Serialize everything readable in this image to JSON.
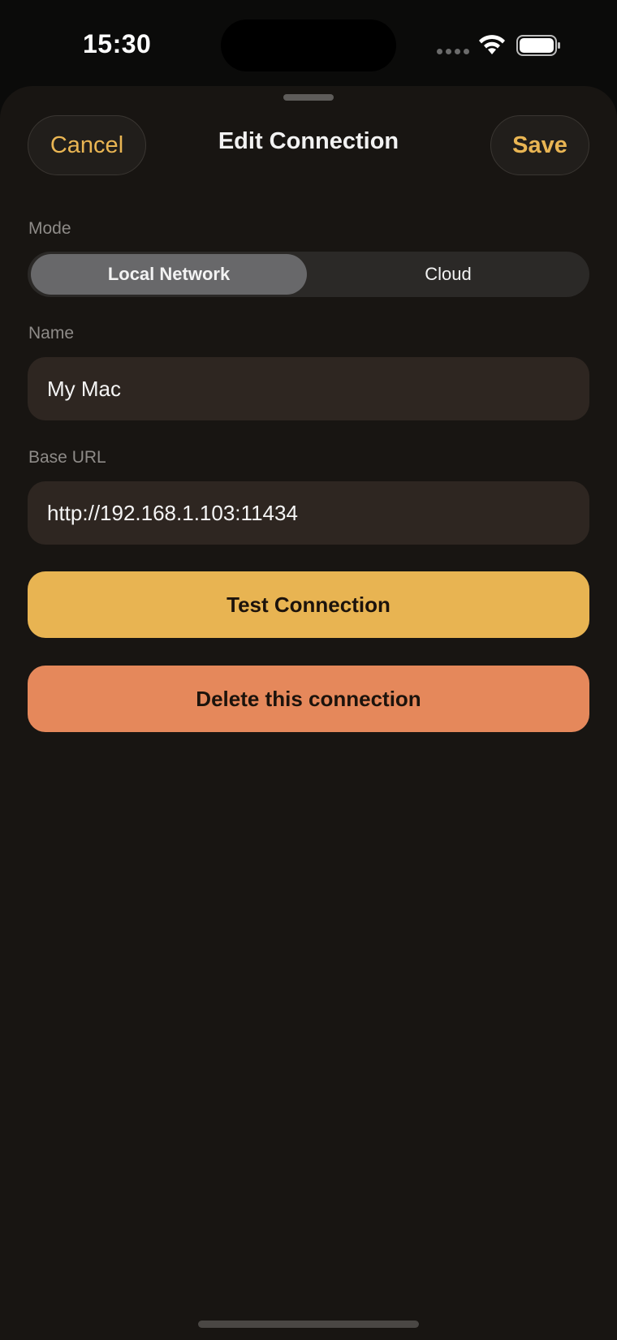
{
  "status_bar": {
    "time": "15:30",
    "icons": [
      "cellular-dots-icon",
      "wifi-icon",
      "battery-icon"
    ]
  },
  "sheet": {
    "cancel_label": "Cancel",
    "title": "Edit Connection",
    "save_label": "Save"
  },
  "mode": {
    "label": "Mode",
    "options": [
      "Local Network",
      "Cloud"
    ],
    "selected": "Local Network"
  },
  "name_field": {
    "label": "Name",
    "value": "My Mac"
  },
  "base_url_field": {
    "label": "Base URL",
    "value": "http://192.168.1.103:11434"
  },
  "actions": {
    "test_label": "Test Connection",
    "delete_label": "Delete this connection"
  },
  "colors": {
    "accent": "#e9b553",
    "test_button": "#e8b452",
    "delete_button": "#e5885b",
    "sheet_background": "#181512",
    "field_background": "#2e2621"
  }
}
